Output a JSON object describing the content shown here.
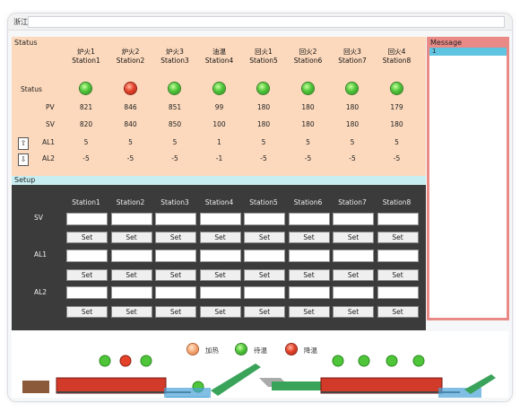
{
  "window": {
    "title": "浙江"
  },
  "status": {
    "title": "Status",
    "row_labels": {
      "status": "Status",
      "pv": "PV",
      "sv": "SV",
      "al1": "AL1",
      "al2": "AL2"
    },
    "stations": [
      {
        "cn": "炉火1",
        "name": "Station1",
        "led": "green",
        "pv": "821",
        "sv": "820",
        "al1": "5",
        "al2": "-5"
      },
      {
        "cn": "炉火2",
        "name": "Station2",
        "led": "red",
        "pv": "846",
        "sv": "840",
        "al1": "5",
        "al2": "-5"
      },
      {
        "cn": "炉火3",
        "name": "Station3",
        "led": "green",
        "pv": "851",
        "sv": "850",
        "al1": "5",
        "al2": "-5"
      },
      {
        "cn": "油温",
        "name": "Station4",
        "led": "green",
        "pv": "99",
        "sv": "100",
        "al1": "1",
        "al2": "-1"
      },
      {
        "cn": "回火1",
        "name": "Station5",
        "led": "green",
        "pv": "180",
        "sv": "180",
        "al1": "5",
        "al2": "-5"
      },
      {
        "cn": "回火2",
        "name": "Station6",
        "led": "green",
        "pv": "180",
        "sv": "180",
        "al1": "5",
        "al2": "-5"
      },
      {
        "cn": "回火3",
        "name": "Station7",
        "led": "green",
        "pv": "180",
        "sv": "180",
        "al1": "5",
        "al2": "-5"
      },
      {
        "cn": "回火4",
        "name": "Station8",
        "led": "green",
        "pv": "179",
        "sv": "180",
        "al1": "5",
        "al2": "-5"
      }
    ],
    "up_arrow": "⇧",
    "down_arrow": "⇩"
  },
  "setup": {
    "title": "Setup",
    "row_labels": {
      "sv": "SV",
      "al1": "AL1",
      "al2": "AL2"
    },
    "station_names": [
      "Station1",
      "Station2",
      "Station3",
      "Station4",
      "Station5",
      "Station6",
      "Station7",
      "Station8"
    ],
    "set_label": "Set"
  },
  "message": {
    "title": "Message",
    "selected_item": "1"
  },
  "legend": [
    {
      "led": "orange",
      "label": "加热"
    },
    {
      "led": "green",
      "label": "待温"
    },
    {
      "led": "red",
      "label": "降温"
    }
  ],
  "colors": {
    "status_bg": "#fcd9bd",
    "setup_bg": "#3b3b3b",
    "message_bg": "#e98a87",
    "furnace_red": "#d23a2a",
    "conveyor_green": "#3aa35a",
    "tank_blue": "#4aa3d8"
  }
}
